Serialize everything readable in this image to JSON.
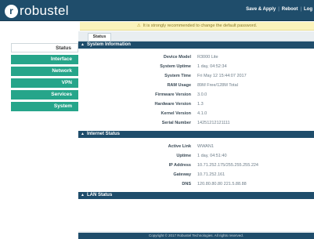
{
  "brand": {
    "logo_mark": "r",
    "logo_text": "robustel"
  },
  "header": {
    "save_apply": "Save & Apply",
    "reboot": "Reboot",
    "logout": "Log"
  },
  "warning": {
    "icon": "warning-triangle",
    "text": "It is strongly recommended to change the default password."
  },
  "tabs": [
    {
      "label": "Status"
    }
  ],
  "sidebar": {
    "items": [
      {
        "label": "Status",
        "active": true
      },
      {
        "label": "Interface",
        "active": false
      },
      {
        "label": "Network",
        "active": false
      },
      {
        "label": "VPN",
        "active": false
      },
      {
        "label": "Services",
        "active": false
      },
      {
        "label": "System",
        "active": false
      }
    ]
  },
  "sections": {
    "system": {
      "title": "System Information",
      "rows": [
        {
          "label": "Device Model",
          "value": "R3000 Lite"
        },
        {
          "label": "System Uptime",
          "value": "1 day, 04:52:34"
        },
        {
          "label": "System Time",
          "value": "Fri May 12 15:44:07 2017"
        },
        {
          "label": "RAM Usage",
          "value": "89M Free/128M Total"
        },
        {
          "label": "Firmware Version",
          "value": "3.0.0"
        },
        {
          "label": "Hardware Version",
          "value": "1.3"
        },
        {
          "label": "Kernel Version",
          "value": "4.1.0"
        },
        {
          "label": "Serial Number",
          "value": "14251212121111"
        }
      ]
    },
    "internet": {
      "title": "Internet Status",
      "rows": [
        {
          "label": "Active Link",
          "value": "WWAN1"
        },
        {
          "label": "Uptime",
          "value": "1 day, 04:51:40"
        },
        {
          "label": "IP Address",
          "value": "10.71.252.175/255.255.255.224"
        },
        {
          "label": "Gateway",
          "value": "10.71.252.161"
        },
        {
          "label": "DNS",
          "value": "120.80.80.80 221.5.88.88"
        }
      ]
    },
    "lan": {
      "title": "LAN Status"
    }
  },
  "footer": {
    "text": "Copyright © 2017 Robustel Technologies. All rights reserved."
  },
  "colors": {
    "header": "#1f4d6b",
    "sidebar": "#26a58a",
    "warning_bg": "#fbf3bb"
  }
}
